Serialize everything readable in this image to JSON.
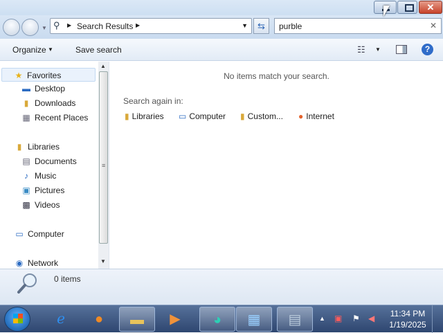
{
  "window": {
    "minimize_label": "—",
    "maximize_label": "□",
    "close_label": "✕"
  },
  "address": {
    "path_label": "Search Results",
    "search_value": "purble",
    "clear_label": "✕"
  },
  "toolbar": {
    "organize_label": "Organize",
    "save_search_label": "Save search",
    "help_label": "?"
  },
  "sidebar": {
    "favorites_label": "Favorites",
    "favorites_items": [
      "Desktop",
      "Downloads",
      "Recent Places"
    ],
    "libraries_label": "Libraries",
    "libraries_items": [
      "Documents",
      "Music",
      "Pictures",
      "Videos"
    ],
    "computer_label": "Computer",
    "network_label": "Network"
  },
  "main": {
    "empty_message": "No items match your search.",
    "search_again_label": "Search again in:",
    "search_locations": [
      "Libraries",
      "Computer",
      "Custom...",
      "Internet"
    ]
  },
  "status": {
    "count_text": "0 items"
  },
  "taskbar": {
    "time": "11:34 PM",
    "date": "1/19/2025"
  },
  "colors": {
    "accent": "#2f6cc9",
    "close_button": "#c7432a"
  }
}
